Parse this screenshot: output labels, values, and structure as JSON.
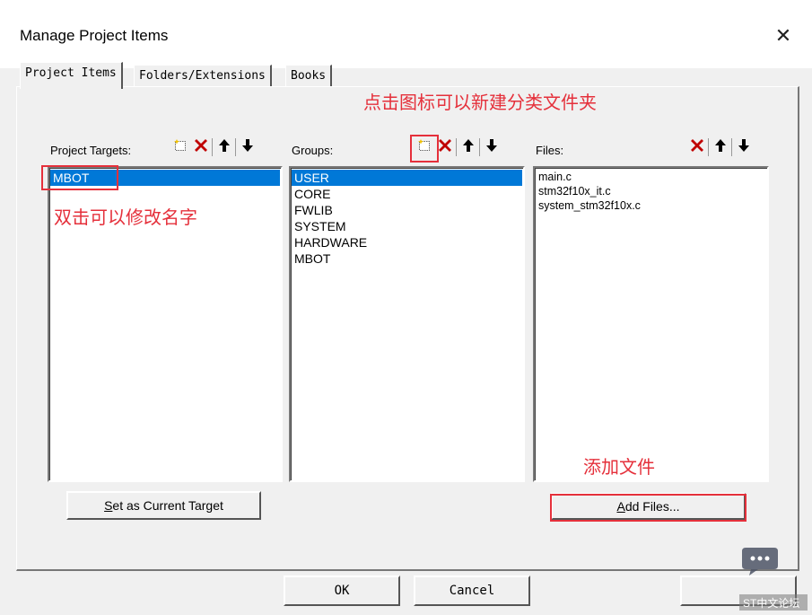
{
  "window": {
    "title": "Manage Project Items",
    "close_glyph": "✕"
  },
  "tabs": [
    {
      "label": "Project Items",
      "active": true
    },
    {
      "label": "Folders/Extensions",
      "active": false
    },
    {
      "label": "Books",
      "active": false
    }
  ],
  "targets": {
    "header": "Project Targets:",
    "items": [
      {
        "label": "MBOT",
        "selected": true
      }
    ]
  },
  "groups": {
    "header": "Groups:",
    "items": [
      {
        "label": "USER",
        "selected": true
      },
      {
        "label": "CORE",
        "selected": false
      },
      {
        "label": "FWLIB",
        "selected": false
      },
      {
        "label": "SYSTEM",
        "selected": false
      },
      {
        "label": "HARDWARE",
        "selected": false
      },
      {
        "label": "MBOT",
        "selected": false
      }
    ]
  },
  "files": {
    "header": "Files:",
    "items": [
      {
        "label": "main.c"
      },
      {
        "label": "stm32f10x_it.c"
      },
      {
        "label": "system_stm32f10x.c"
      }
    ]
  },
  "buttons": {
    "set_target": {
      "pre": "",
      "mnemonic": "S",
      "post": "et as Current Target"
    },
    "add_files": {
      "pre": "",
      "mnemonic": "A",
      "post": "dd Files..."
    },
    "ok": "OK",
    "cancel": "Cancel"
  },
  "annotations": {
    "new_folder_hint": "点击图标可以新建分类文件夹",
    "rename_hint": "双击可以修改名字",
    "add_file_hint": "添加文件"
  },
  "watermark": {
    "text": "ST中文论坛"
  },
  "icons": {
    "new": "new-item-icon",
    "delete": "delete-x-icon",
    "up": "arrow-up-icon",
    "down": "arrow-down-icon"
  },
  "colors": {
    "selection": "#0078d7",
    "annotation": "#e5303b"
  }
}
